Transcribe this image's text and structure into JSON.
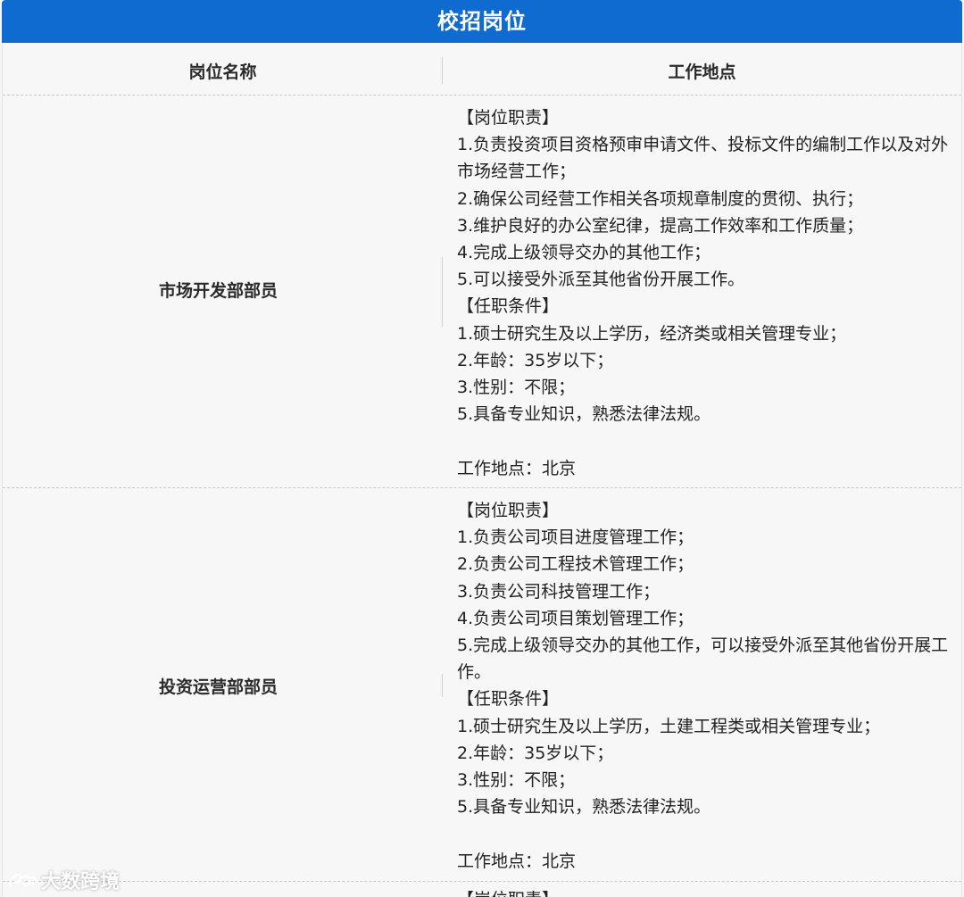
{
  "header": {
    "title": "校招岗位"
  },
  "table": {
    "columns": [
      "岗位名称",
      "工作地点"
    ],
    "rows": [
      {
        "name": "市场开发部部员",
        "lines": [
          "【岗位职责】",
          "1.负责投资项目资格预审申请文件、投标文件的编制工作以及对外市场经营工作；",
          "2.确保公司经营工作相关各项规章制度的贯彻、执行；",
          "3.维护良好的办公室纪律，提高工作效率和工作质量；",
          "4.完成上级领导交办的其他工作；",
          "5.可以接受外派至其他省份开展工作。",
          "【任职条件】",
          "1.硕士研究生及以上学历，经济类或相关管理专业；",
          "2.年龄：35岁以下；",
          "3.性别：不限；",
          "5.具备专业知识，熟悉法律法规。",
          "",
          "工作地点：北京"
        ]
      },
      {
        "name": "投资运营部部员",
        "lines": [
          "【岗位职责】",
          "1.负责公司项目进度管理工作；",
          "2.负责公司工程技术管理工作；",
          "3.负责公司科技管理工作；",
          "4.负责公司项目策划管理工作；",
          "5.完成上级领导交办的其他工作，可以接受外派至其他省份开展工作。",
          "【任职条件】",
          "1.硕士研究生及以上学历，土建工程类或相关管理专业；",
          "2.年龄：35岁以下；",
          "3.性别：不限；",
          "5.具备专业知识，熟悉法律法规。",
          "",
          "工作地点：北京"
        ]
      }
    ],
    "next_row_partial": "【岗位职责】"
  },
  "watermark": {
    "text": "大数跨境"
  }
}
